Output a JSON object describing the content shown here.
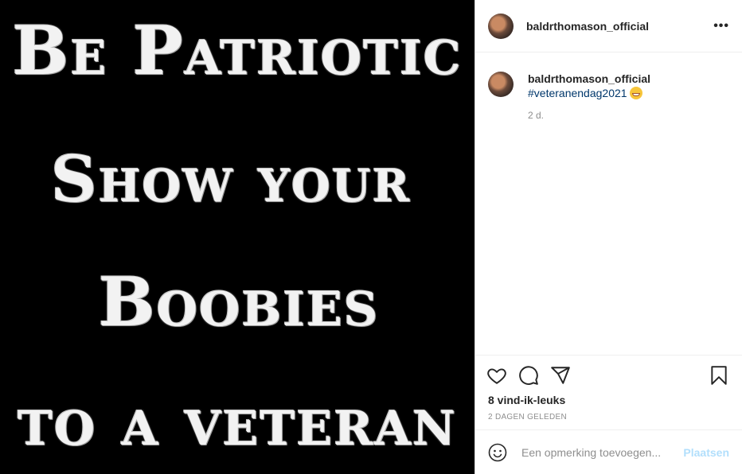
{
  "image": {
    "lines": [
      "Be Patriotic",
      "Show your",
      "Boobies",
      "to a veteran"
    ]
  },
  "header": {
    "username": "baldrthomason_official",
    "more_label": "•••"
  },
  "caption": {
    "username": "baldrthomason_official",
    "hashtag": "#veteranendag2021",
    "time": "2 d."
  },
  "actions": {
    "icons": [
      "heart-icon",
      "comment-icon",
      "share-icon",
      "bookmark-icon"
    ],
    "likes": "8 vind-ik-leuks",
    "date": "2 DAGEN GELEDEN"
  },
  "comment": {
    "placeholder": "Een opmerking toevoegen...",
    "post_label": "Plaatsen"
  },
  "colors": {
    "hashtag": "#00376b",
    "post_button": "#b2dffc",
    "muted": "#8e8e8e"
  }
}
